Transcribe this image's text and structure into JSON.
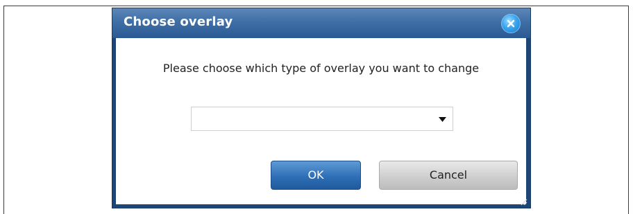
{
  "dialog": {
    "title": "Choose overlay",
    "close_icon": "close-icon",
    "message": "Please choose which type of overlay you want to change",
    "overlay_select": {
      "selected_value": "",
      "icon": "chevron-down-icon"
    },
    "buttons": {
      "ok_label": "OK",
      "cancel_label": "Cancel"
    },
    "resize_icon": "resize-grip-icon"
  },
  "colors": {
    "titlebar": "#2b5a93",
    "ok_button": "#2f6fb6",
    "cancel_button": "#cfcfcf",
    "close_button": "#3aa6ef"
  }
}
